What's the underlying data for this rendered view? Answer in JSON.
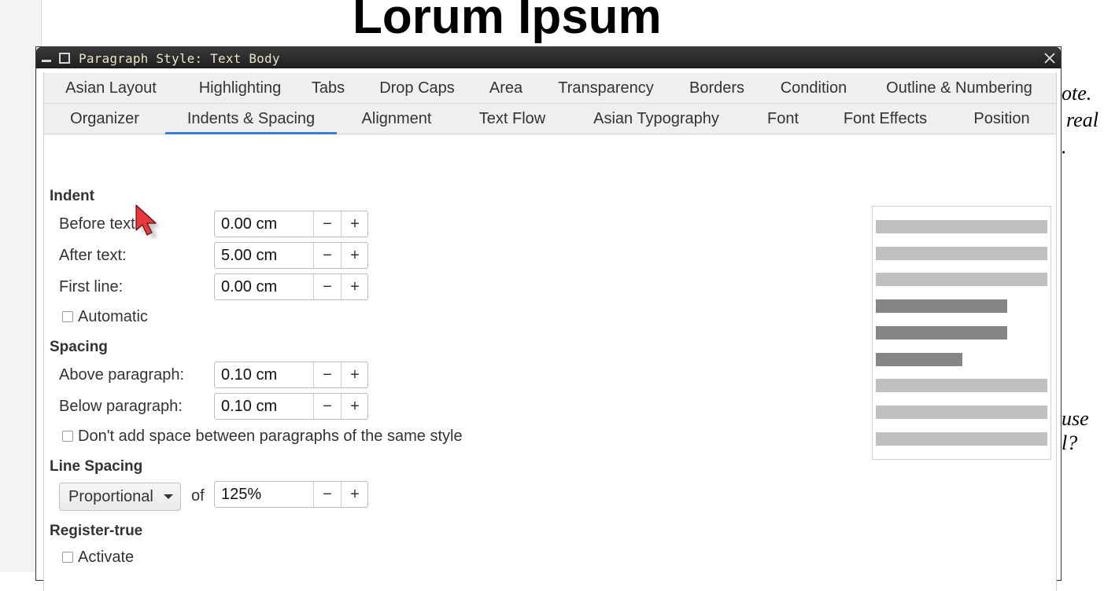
{
  "document": {
    "title": "Lorum Ipsum",
    "fragments": [
      "ote.",
      "real",
      ".",
      "use",
      "l?"
    ]
  },
  "dialog": {
    "title": "Paragraph Style: Text Body",
    "tabs_row1": [
      "Asian Layout",
      "Highlighting",
      "Tabs",
      "Drop Caps",
      "Area",
      "Transparency",
      "Borders",
      "Condition",
      "Outline & Numbering"
    ],
    "tabs_row2": [
      "Organizer",
      "Indents & Spacing",
      "Alignment",
      "Text Flow",
      "Asian Typography",
      "Font",
      "Font Effects",
      "Position"
    ],
    "active_tab": "Indents & Spacing",
    "indent": {
      "title": "Indent",
      "before_text": {
        "label": "Before text:",
        "value": "0.00 cm"
      },
      "after_text": {
        "label": "After text:",
        "value": "5.00 cm"
      },
      "first_line": {
        "label": "First line:",
        "value": "0.00 cm"
      },
      "automatic": {
        "label": "Automatic",
        "checked": false
      }
    },
    "spacing": {
      "title": "Spacing",
      "above": {
        "label": "Above paragraph:",
        "value": "0.10 cm"
      },
      "below": {
        "label": "Below paragraph:",
        "value": "0.10 cm"
      },
      "no_space_same_style": {
        "label": "Don't add space between paragraphs of the same style",
        "checked": false
      }
    },
    "line_spacing": {
      "title": "Line Spacing",
      "mode": "Proportional",
      "of_label": "of",
      "value": "125%"
    },
    "register_true": {
      "title": "Register-true",
      "activate": {
        "label": "Activate",
        "checked": false
      }
    },
    "spin_minus": "−",
    "spin_plus": "+"
  },
  "colors": {
    "accent": "#3d7fd6",
    "preview_light": "#c0c0c0",
    "preview_dark": "#858585",
    "titlebar_text": "#e9e4c8"
  },
  "icons": [
    "minimize-icon",
    "maximize-icon",
    "close-icon",
    "dropdown-arrow-icon",
    "mouse-cursor-icon"
  ]
}
